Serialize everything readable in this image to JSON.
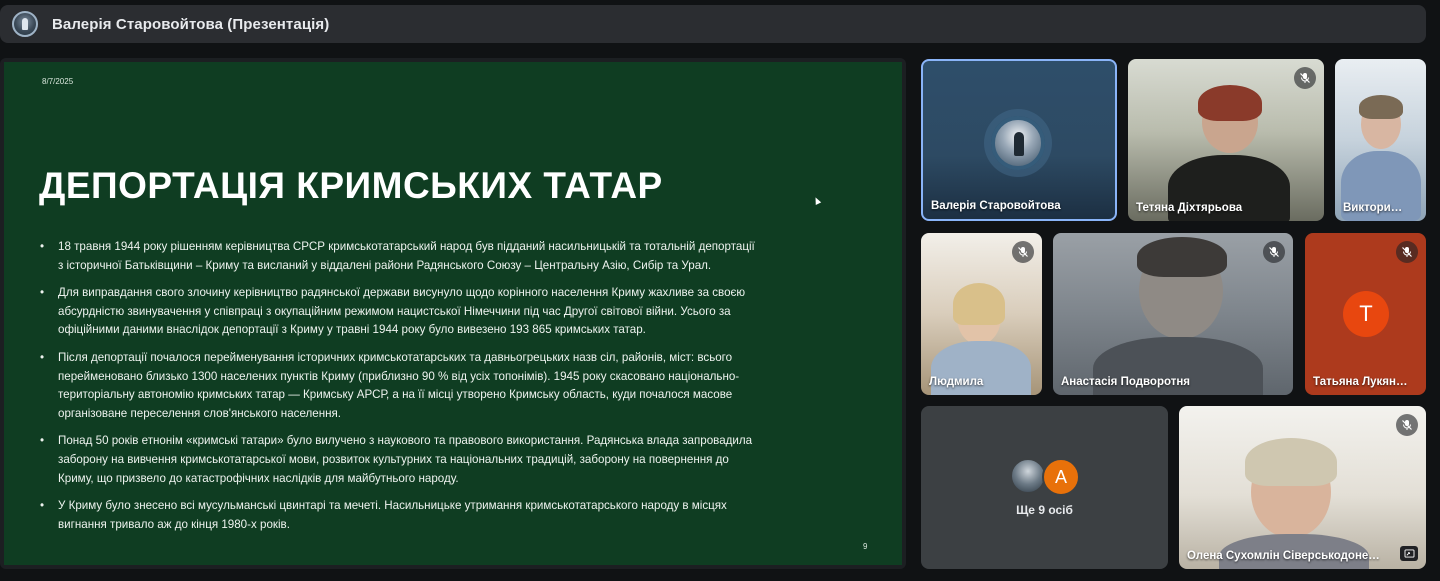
{
  "topbar": {
    "title": "Валерія Старовойтова (Презентація)",
    "avatar_icon": "presenter-avatar"
  },
  "slide": {
    "date": "8/7/2025",
    "heading": "ДЕПОРТАЦІЯ КРИМСЬКИХ ТАТАР",
    "page_number": "9",
    "bullets": [
      "18 травня 1944 року рішенням керівництва СРСР кримськотатарський народ був підданий насильницькій та тотальній депортації з історичної Батьківщини – Криму та висланий у віддалені райони Радянського Союзу – Центральну Азію, Сибір та Урал.",
      "Для виправдання свого злочину керівництво радянської держави висунуло щодо корінного населення Криму жахливе за своєю абсурдністю звинувачення у співпраці з окупаційним режимом нацистської Німеччини під час Другої світової війни. Усього за офіційними даними внаслідок депортації з Криму у травні 1944 року було вивезено 193 865 кримських татар.",
      "Після депортації почалося перейменування історичних кримськотатарських та давньогрецьких назв сіл, районів, міст: всього перейменовано близько 1300 населених пунктів Криму (приблизно 90 % від усіх топонімів). 1945 року скасовано національно-територіальну автономію кримських татар — Кримську АРСР, а на її місці утворено Кримську область, куди почалося масове організоване переселення слов'янського населення.",
      "Понад 50 років етнонім «кримські татари» було вилучено з наукового та правового використання. Радянська влада запровадила заборону на вивчення кримськотатарської мови, розвиток культурних та національних традицій, заборону на повернення до Криму, що призвело до катастрофічних наслідків для майбутнього народу.",
      "У Криму було знесено всі мусульманські цвинтарі та мечеті. Насильницьке утримання кримськотатарського народу в місцях вигнання тривало аж до кінця 1980-х років."
    ]
  },
  "participants": {
    "valeria": {
      "name": "Валерія Старовойтова"
    },
    "tetiana": {
      "name": "Тетяна Діхтярьова",
      "muted_icon": "mic-off-icon"
    },
    "viktoria": {
      "name": "Виктори…"
    },
    "ludmyla": {
      "name": "Людмила",
      "muted_icon": "mic-off-icon"
    },
    "anastasia": {
      "name": "Анастасія Подворотня",
      "muted_icon": "mic-off-icon"
    },
    "tatiana": {
      "name": "Татьяна Лукян…",
      "initial": "T",
      "muted_icon": "mic-off-icon"
    },
    "more": {
      "label": "Ще 9 осіб",
      "initial": "A"
    },
    "olena": {
      "name": "Олена Сухомлін Сіверськодоне…",
      "muted_icon": "mic-off-icon"
    }
  },
  "colors": {
    "slide_bg": "#0f3d22",
    "active_speaker_border": "#8ab4f8",
    "tatiana_tile": "#ad3a1d",
    "initial_orange": "#e8710a"
  }
}
